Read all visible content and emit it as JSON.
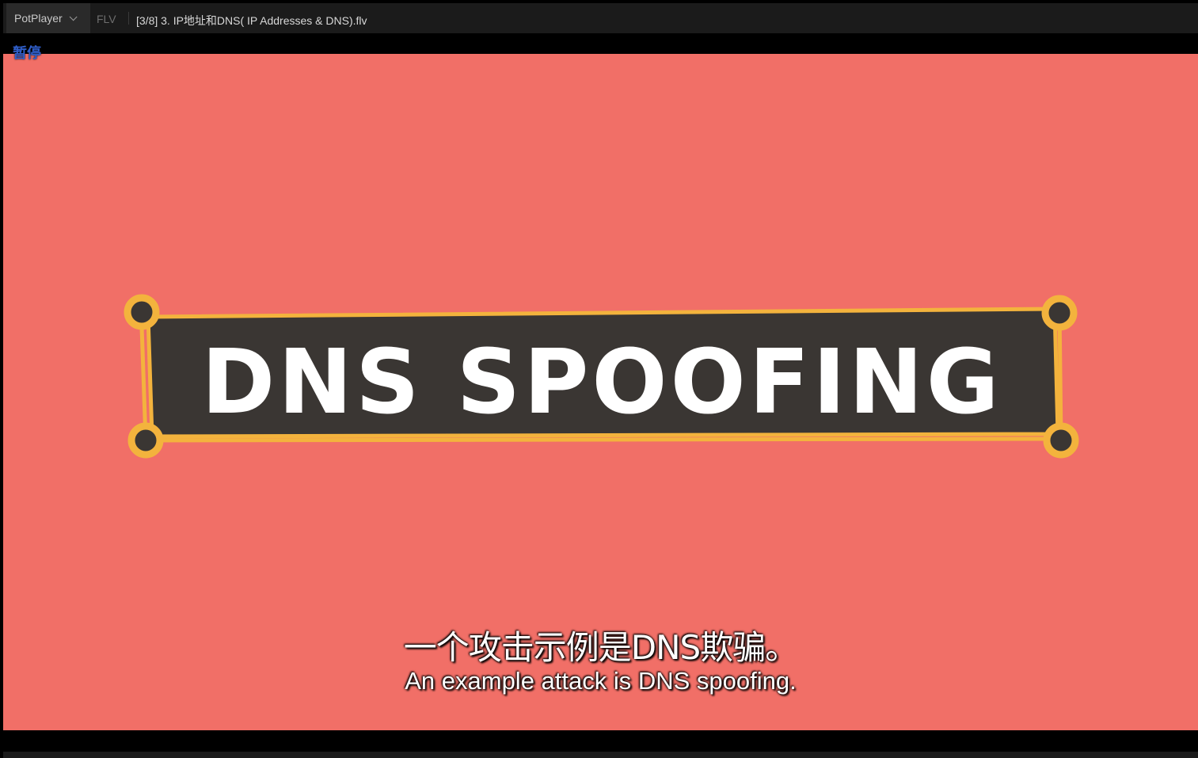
{
  "titlebar": {
    "app_name": "PotPlayer",
    "format": "FLV",
    "file_title": "[3/8] 3. IP地址和DNS( IP Addresses & DNS).flv"
  },
  "status": {
    "pause_label": "暂停"
  },
  "video": {
    "banner_text": "DNS SPOOFING",
    "subtitle_cn": "一个攻击示例是DNS欺骗。",
    "subtitle_en": "An example attack is DNS spoofing.",
    "colors": {
      "background": "#f16f67",
      "banner": "#3a3633",
      "border": "#f3b33d",
      "text": "#ffffff"
    }
  }
}
